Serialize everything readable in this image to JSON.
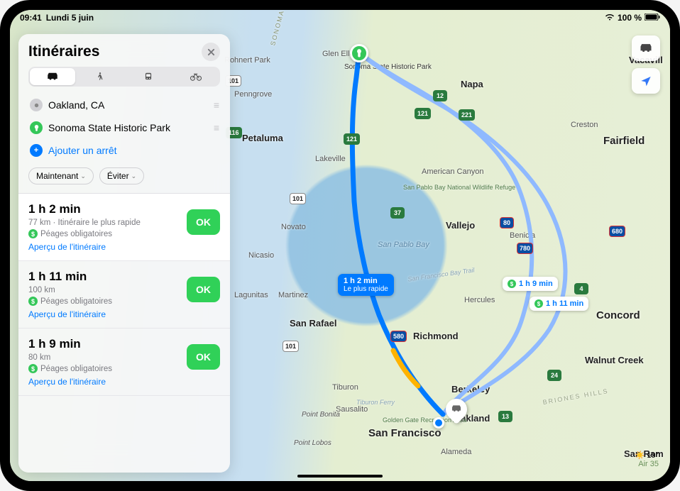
{
  "status": {
    "time": "09:41",
    "date": "Lundi 5 juin",
    "battery": "100 %"
  },
  "panel": {
    "title": "Itinéraires",
    "modes": [
      "car",
      "walk",
      "transit",
      "bike"
    ],
    "stops": {
      "origin": "Oakland, CA",
      "destination": "Sonoma State Historic Park",
      "add_label": "Ajouter un arrêt"
    },
    "options": {
      "when": "Maintenant",
      "avoid": "Éviter"
    },
    "routes": [
      {
        "time": "1 h 2 min",
        "sub": "77 km · Itinéraire le plus rapide",
        "toll": "Péages obligatoires",
        "preview": "Aperçu de l'itinéraire",
        "ok": "OK"
      },
      {
        "time": "1 h 11 min",
        "sub": "100 km",
        "toll": "Péages obligatoires",
        "preview": "Aperçu de l'itinéraire",
        "ok": "OK"
      },
      {
        "time": "1 h 9 min",
        "sub": "80 km",
        "toll": "Péages obligatoires",
        "preview": "Aperçu de l'itinéraire",
        "ok": "OK"
      }
    ]
  },
  "map": {
    "badges": {
      "primary": {
        "time": "1 h 2 min",
        "tag": "Le plus rapide"
      },
      "alt1": "1 h 9 min",
      "alt2": "1 h 11 min"
    },
    "labels": {
      "san_francisco": "San Francisco",
      "oakland": "Oakland",
      "berkeley": "Berkeley",
      "richmond": "Richmond",
      "san_rafael": "San Rafael",
      "napa": "Napa",
      "vallejo": "Vallejo",
      "fairfield": "Fairfield",
      "concord": "Concord",
      "walnut_creek": "Walnut Creek",
      "novato": "Novato",
      "petaluma": "Petaluma",
      "vacaville": "Vacavill",
      "alameda": "Alameda",
      "penngrove": "Penngrove",
      "rohnert_park": "Rohnert Park",
      "sausalito": "Sausalito",
      "tiburon": "Tiburon",
      "lakeville": "Lakeville",
      "glen_ellen": "Glen Ellen",
      "american_canyon": "American Canyon",
      "hercules": "Hercules",
      "martinez": "Martinez",
      "san_ramon": "San Ram",
      "creston": "Creston",
      "lagunitas": "Lagunitas",
      "nicasio": "Nicasio",
      "point_bonita": "Point Bonita",
      "point_lobos": "Point Lobos",
      "sonoma_mountains": "SONOMA MOUNTAINS",
      "san_pablo_bay": "San Pablo Bay",
      "san_francisco_bay_trail": "San Francisco Bay Trail",
      "briones_hills": "BRIONES HILLS",
      "tiburon_ferry": "Tiburon Ferry",
      "wildlife_refuge": "San Pablo Bay National Wildlife Refuge",
      "sonoma_park": "Sonoma State Historic Park",
      "golden_gate": "Golden Gate Recreation Area",
      "benicia": "Benicia"
    },
    "shields": {
      "i80": "80",
      "i580": "580",
      "i680": "680",
      "i780": "780",
      "us101_a": "101",
      "us101_b": "101",
      "us101_c": "101",
      "ca37": "37",
      "ca121_a": "121",
      "ca121_b": "121",
      "ca221": "221",
      "ca12": "12",
      "ca116": "116",
      "ca4": "4",
      "ca13": "13",
      "ca24": "24"
    }
  },
  "weather": {
    "temp": "19°",
    "aqi": "Air 35"
  }
}
